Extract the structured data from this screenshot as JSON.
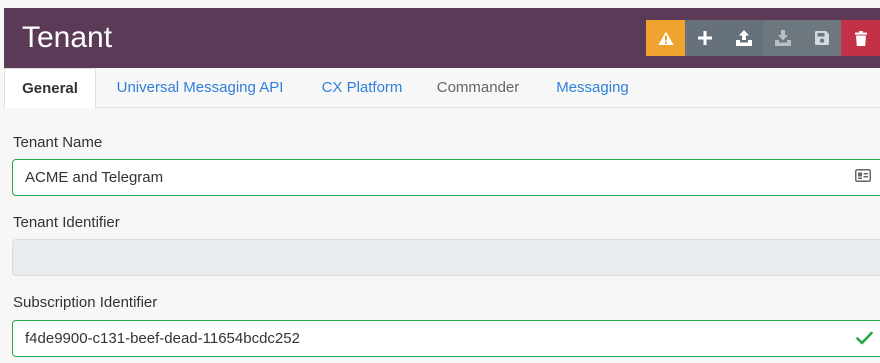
{
  "header": {
    "title": "Tenant",
    "colors": {
      "background": "#5b3a57",
      "warning": "#f0a430",
      "danger": "#c23145"
    },
    "toolbar": [
      {
        "icon": "warning-icon",
        "state": "warning"
      },
      {
        "icon": "plus-icon",
        "state": "enabled"
      },
      {
        "icon": "upload-icon",
        "state": "enabled"
      },
      {
        "icon": "download-icon",
        "state": "disabled"
      },
      {
        "icon": "save-icon",
        "state": "disabled"
      },
      {
        "icon": "trash-icon",
        "state": "danger"
      }
    ]
  },
  "tabs": [
    {
      "label": "General",
      "active": true
    },
    {
      "label": "Universal Messaging API",
      "active": false
    },
    {
      "label": "CX Platform",
      "active": false
    },
    {
      "label": "Commander",
      "active": false
    },
    {
      "label": "Messaging",
      "active": false
    }
  ],
  "form": {
    "tenant_name": {
      "label": "Tenant Name",
      "value": "ACME and Telegram",
      "icon": "id-card-icon"
    },
    "tenant_identifier": {
      "label": "Tenant Identifier",
      "value": ""
    },
    "subscription_identifier": {
      "label": "Subscription Identifier",
      "value": "f4de9900-c131-beef-dead-11654bcdc252",
      "icon": "checkmark-icon"
    }
  }
}
